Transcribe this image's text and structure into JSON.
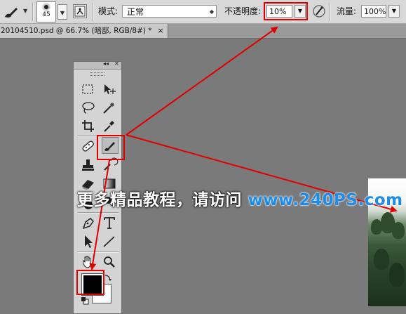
{
  "options_bar": {
    "brush_size": "45",
    "mode_label": "模式:",
    "mode_value": "正常",
    "opacity_label": "不透明度:",
    "opacity_value": "10%",
    "flow_label": "流量:",
    "flow_value": "100%"
  },
  "document_tab": {
    "title": "20104510.psd @ 66.7% (暗部, RGB/8#) *",
    "close": "×"
  },
  "tools_panel": {
    "collapse_glyph": "◂◂",
    "close_glyph": "✕",
    "tools": [
      "marquee-tool",
      "move-tool",
      "lasso-tool",
      "magic-wand-tool",
      "crop-tool",
      "eyedropper-tool",
      "spot-healing-tool",
      "brush-tool",
      "clone-stamp-tool",
      "history-brush-tool",
      "eraser-tool",
      "gradient-tool",
      "blur-tool",
      "dodge-tool",
      "pen-tool",
      "type-tool",
      "path-selection-tool",
      "line-tool",
      "hand-tool",
      "zoom-tool"
    ],
    "selected_tool": "brush-tool",
    "foreground_color": "#000000",
    "background_color": "#ffffff"
  },
  "watermark": {
    "text_cn": "更多精品教程，请访问",
    "url": "www.240PS.com"
  },
  "colors": {
    "highlight": "#e00000",
    "arrow": "#e00000",
    "workspace": "#7a7a7a",
    "url_blue": "#1f8ce6"
  }
}
